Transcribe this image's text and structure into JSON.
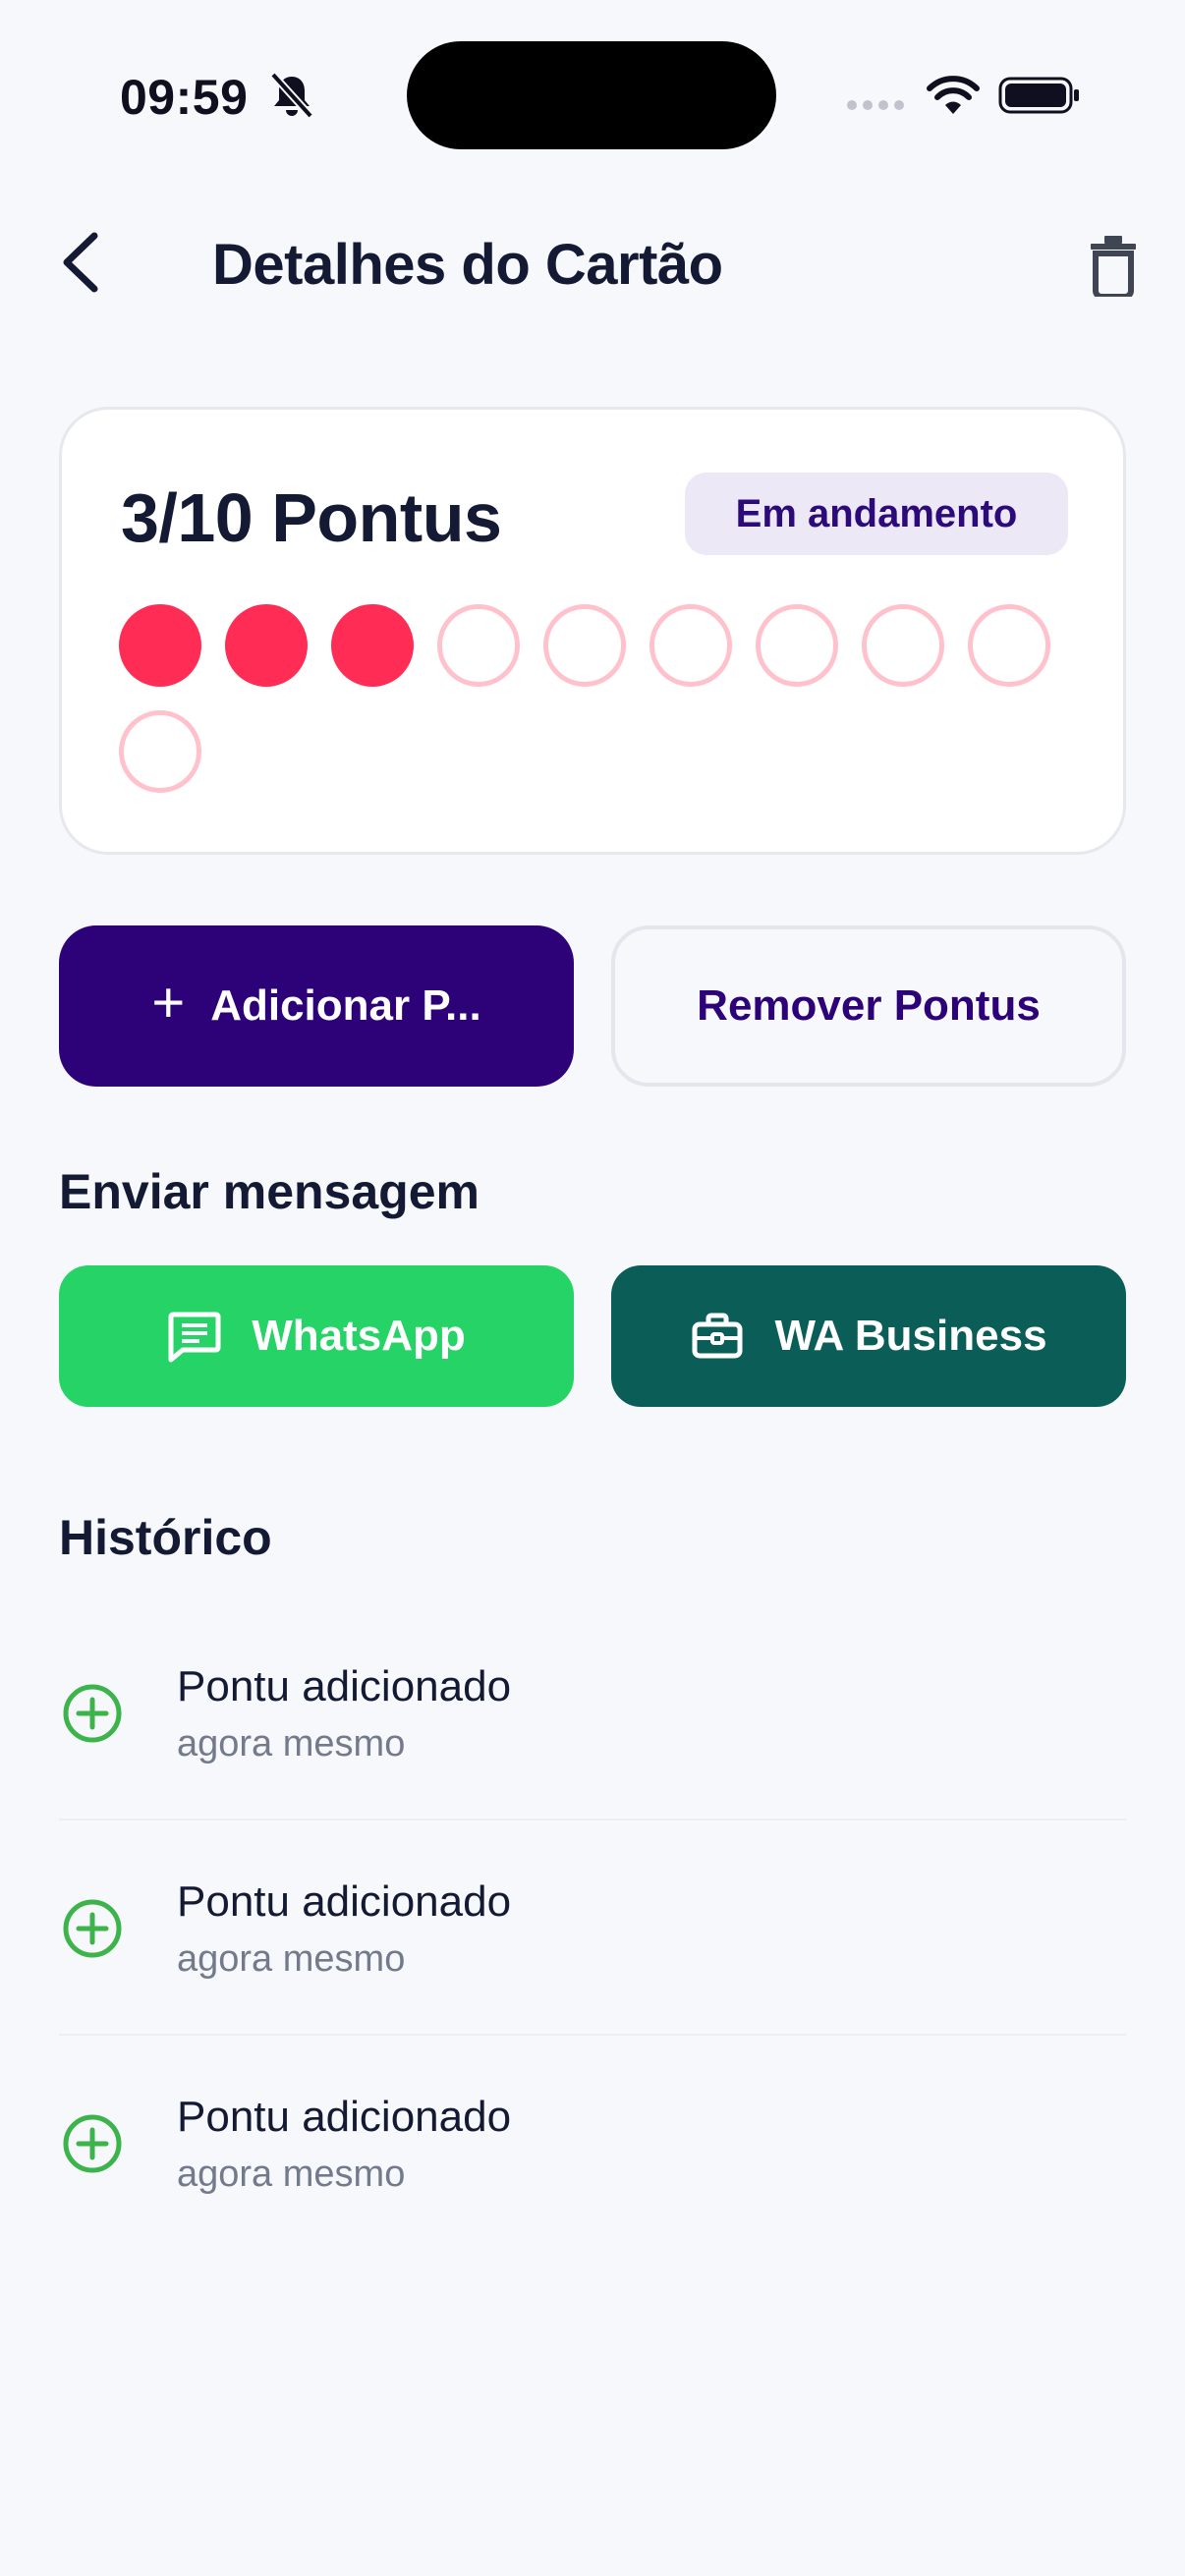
{
  "status_bar": {
    "time": "09:59"
  },
  "header": {
    "title": "Detalhes do Cartão"
  },
  "card": {
    "points_label": "3/10 Pontus",
    "status_badge": "Em andamento",
    "points_filled": 3,
    "points_total": 10
  },
  "actions": {
    "add_label": "Adicionar P...",
    "remove_label": "Remover Pontus"
  },
  "message": {
    "section_title": "Enviar mensagem",
    "whatsapp_label": "WhatsApp",
    "wa_business_label": "WA Business"
  },
  "history": {
    "section_title": "Histórico",
    "items": [
      {
        "title": "Pontu adicionado",
        "time": "agora mesmo"
      },
      {
        "title": "Pontu adicionado",
        "time": "agora mesmo"
      },
      {
        "title": "Pontu adicionado",
        "time": "agora mesmo"
      }
    ]
  },
  "icons": {
    "back": "chevron-left-icon",
    "trash": "trash-icon",
    "add": "plus-icon",
    "whatsapp": "message-icon",
    "wa_business": "briefcase-icon",
    "history_item": "plus-circle-icon"
  },
  "colors": {
    "primary": "#2d0278",
    "point_filled": "#ff2d55",
    "point_empty_border": "#ffc2cd",
    "whatsapp": "#25d366",
    "wa_business": "#0b5e58",
    "history_icon": "#3cb44b"
  }
}
